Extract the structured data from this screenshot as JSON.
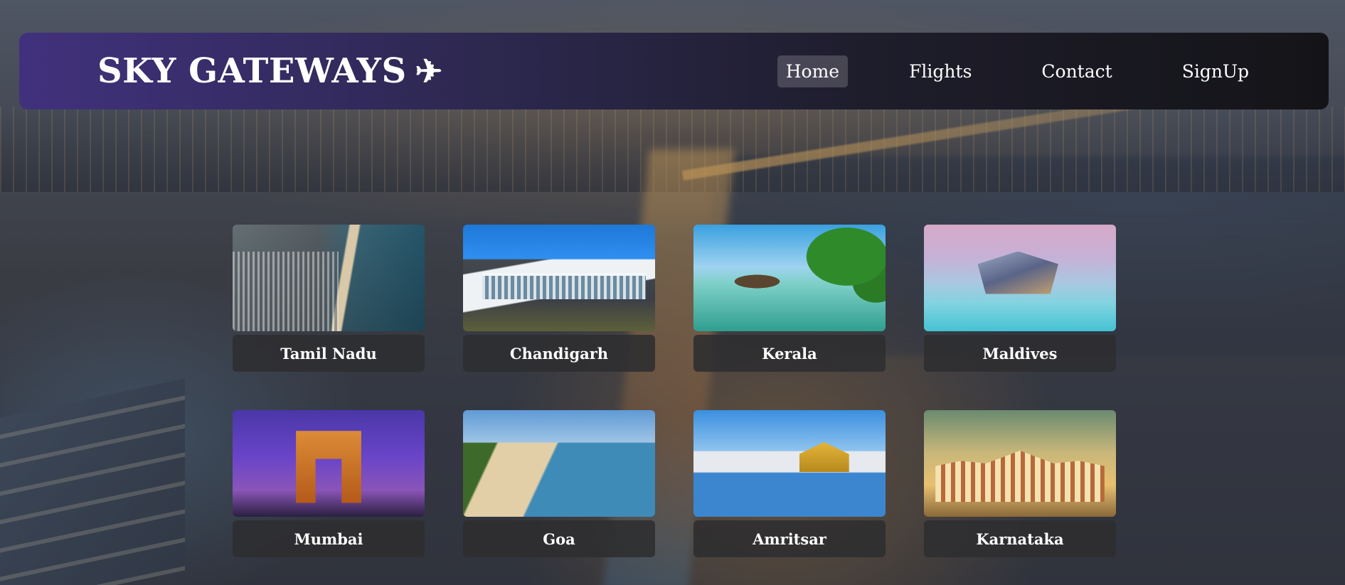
{
  "brand": {
    "title": "SKY GATEWAYS",
    "icon": "airplane-icon",
    "icon_glyph": "✈"
  },
  "nav": {
    "items": [
      {
        "label": "Home",
        "active": true
      },
      {
        "label": "Flights",
        "active": false
      },
      {
        "label": "Contact",
        "active": false
      },
      {
        "label": "SignUp",
        "active": false
      }
    ]
  },
  "destinations": [
    {
      "label": "Tamil Nadu"
    },
    {
      "label": "Chandigarh"
    },
    {
      "label": "Kerala"
    },
    {
      "label": "Maldives"
    },
    {
      "label": "Mumbai"
    },
    {
      "label": "Goa"
    },
    {
      "label": "Amritsar"
    },
    {
      "label": "Karnataka"
    }
  ],
  "colors": {
    "navbar_gradient_start": "#41317d",
    "navbar_gradient_end": "#141418",
    "card_label_bg": "#2d2d30",
    "text": "#ffffff"
  }
}
